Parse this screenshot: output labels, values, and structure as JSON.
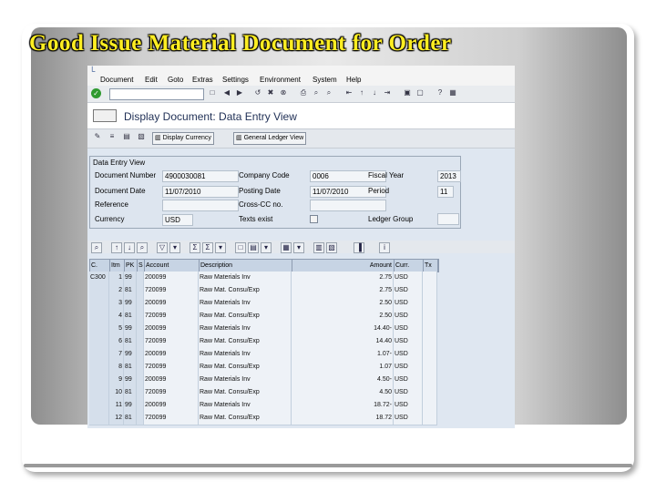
{
  "slide": {
    "title": "Good Issue Material Document for Order"
  },
  "window": {
    "menu": [
      "Document",
      "Edit",
      "Goto",
      "Extras",
      "Settings",
      "Environment",
      "System",
      "Help"
    ],
    "screen_title": "Display Document: Data Entry View",
    "app_buttons": [
      "Display Currency",
      "General Ledger View"
    ]
  },
  "header": {
    "group_title": "Data Entry View",
    "fields": {
      "document_number": {
        "label": "Document Number",
        "value": "4900030081"
      },
      "company_code": {
        "label": "Company Code",
        "value": "0006"
      },
      "fiscal_year": {
        "label": "Fiscal Year",
        "value": "2013"
      },
      "document_date": {
        "label": "Document Date",
        "value": "11/07/2010"
      },
      "posting_date": {
        "label": "Posting Date",
        "value": "11/07/2010"
      },
      "period": {
        "label": "Period",
        "value": "11"
      },
      "reference": {
        "label": "Reference",
        "value": ""
      },
      "cross_cc_no": {
        "label": "Cross-CC no.",
        "value": ""
      },
      "currency": {
        "label": "Currency",
        "value": "USD"
      },
      "texts_exist": {
        "label": "Texts exist",
        "value": ""
      },
      "ledger_group": {
        "label": "Ledger Group",
        "value": ""
      }
    }
  },
  "grid": {
    "columns": [
      "C.",
      "Itm",
      "PK",
      "S",
      "Account",
      "Description",
      "Amount",
      "Curr.",
      "Tx"
    ],
    "rows": [
      [
        "C300",
        "1",
        "99",
        "",
        "200099",
        "Raw Materials Inv",
        "2.75",
        "USD",
        ""
      ],
      [
        "",
        "2",
        "81",
        "",
        "720099",
        "Raw Mat. Consu/Exp",
        "2.75",
        "USD",
        ""
      ],
      [
        "",
        "3",
        "99",
        "",
        "200099",
        "Raw Materials Inv",
        "2.50",
        "USD",
        ""
      ],
      [
        "",
        "4",
        "81",
        "",
        "720099",
        "Raw Mat. Consu/Exp",
        "2.50",
        "USD",
        ""
      ],
      [
        "",
        "5",
        "99",
        "",
        "200099",
        "Raw Materials Inv",
        "14.40-",
        "USD",
        ""
      ],
      [
        "",
        "6",
        "81",
        "",
        "720099",
        "Raw Mat. Consu/Exp",
        "14.40",
        "USD",
        ""
      ],
      [
        "",
        "7",
        "99",
        "",
        "200099",
        "Raw Materials Inv",
        "1.07-",
        "USD",
        ""
      ],
      [
        "",
        "8",
        "81",
        "",
        "720099",
        "Raw Mat. Consu/Exp",
        "1.07",
        "USD",
        ""
      ],
      [
        "",
        "9",
        "99",
        "",
        "200099",
        "Raw Materials Inv",
        "4.50-",
        "USD",
        ""
      ],
      [
        "",
        "10",
        "81",
        "",
        "720099",
        "Raw Mat. Consu/Exp",
        "4.50",
        "USD",
        ""
      ],
      [
        "",
        "11",
        "99",
        "",
        "200099",
        "Raw Materials Inv",
        "18.72-",
        "USD",
        ""
      ],
      [
        "",
        "12",
        "81",
        "",
        "720099",
        "Raw Mat. Consu/Exp",
        "18.72",
        "USD",
        ""
      ]
    ]
  }
}
